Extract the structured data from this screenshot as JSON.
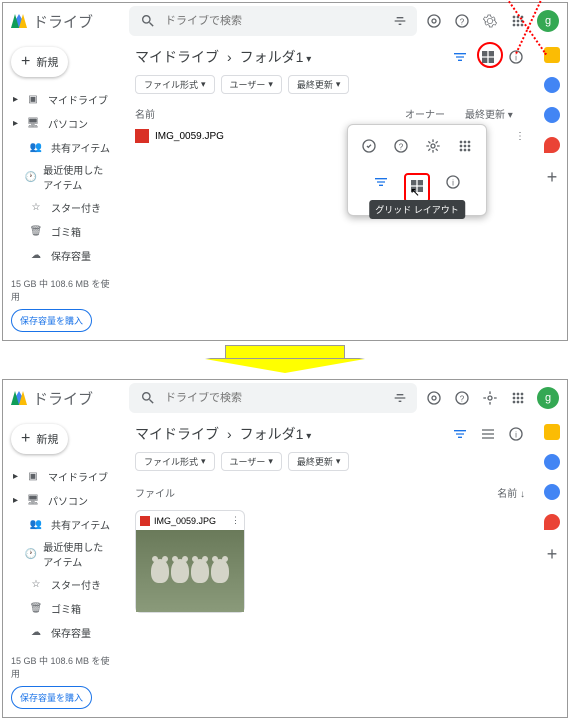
{
  "app": {
    "name": "ドライブ",
    "avatar": "g"
  },
  "search": {
    "placeholder": "ドライブで検索"
  },
  "new_btn": "新規",
  "sidebar": {
    "items": [
      "マイドライブ",
      "パソコン",
      "共有アイテム",
      "最近使用したアイテム",
      "スター付き",
      "ゴミ箱",
      "保存容量"
    ]
  },
  "storage": {
    "text": "15 GB 中 108.6 MB を使用",
    "buy": "保存容量を購入"
  },
  "breadcrumb": {
    "root": "マイドライブ",
    "sep": "›",
    "folder": "フォルダ1"
  },
  "chips": [
    "ファイル形式",
    "ユーザー",
    "最終更新"
  ],
  "columns": {
    "name": "名前",
    "owner": "オーナー",
    "modified": "最終更新"
  },
  "file": {
    "name": "IMG_0059.JPG"
  },
  "tooltip": "グリッド レイアウト",
  "section": "ファイル",
  "sort": "名前"
}
